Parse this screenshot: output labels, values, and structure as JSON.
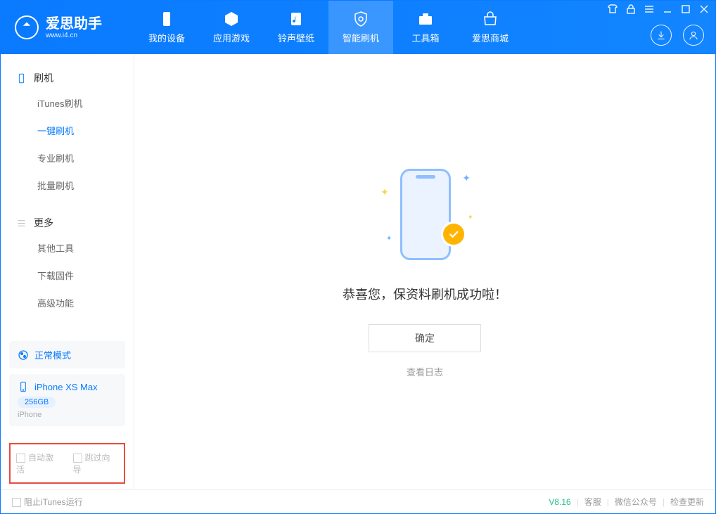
{
  "app": {
    "name": "爱思助手",
    "site": "www.i4.cn"
  },
  "tabs": [
    {
      "label": "我的设备"
    },
    {
      "label": "应用游戏"
    },
    {
      "label": "铃声壁纸"
    },
    {
      "label": "智能刷机"
    },
    {
      "label": "工具箱"
    },
    {
      "label": "爱思商城"
    }
  ],
  "sidebar": {
    "section1_title": "刷机",
    "items1": [
      {
        "label": "iTunes刷机"
      },
      {
        "label": "一键刷机"
      },
      {
        "label": "专业刷机"
      },
      {
        "label": "批量刷机"
      }
    ],
    "section2_title": "更多",
    "items2": [
      {
        "label": "其他工具"
      },
      {
        "label": "下载固件"
      },
      {
        "label": "高级功能"
      }
    ]
  },
  "mode_card": {
    "label": "正常模式"
  },
  "device_card": {
    "name": "iPhone XS Max",
    "storage": "256GB",
    "type": "iPhone"
  },
  "bottom_opts": {
    "auto_activate": "自动激活",
    "skip_guide": "跳过向导"
  },
  "main": {
    "success_text": "恭喜您，保资料刷机成功啦！",
    "ok_button": "确定",
    "view_log": "查看日志"
  },
  "statusbar": {
    "block_itunes": "阻止iTunes运行",
    "version": "V8.16",
    "links": [
      "客服",
      "微信公众号",
      "检查更新"
    ]
  }
}
